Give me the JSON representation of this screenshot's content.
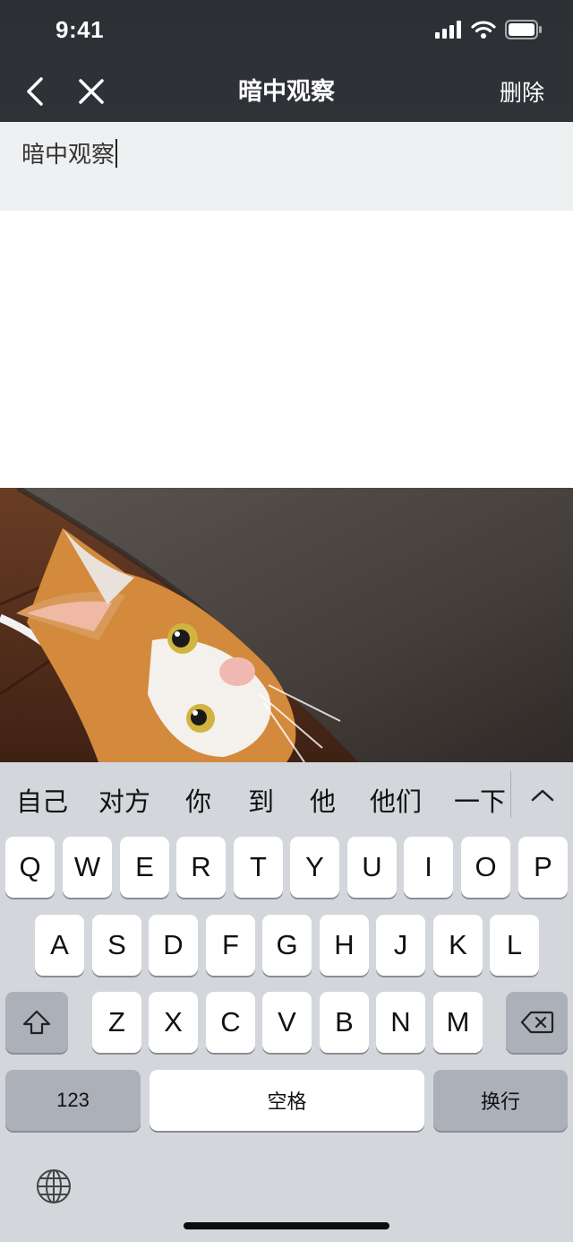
{
  "status_bar": {
    "time": "9:41"
  },
  "nav": {
    "title": "暗中观察",
    "delete_label": "删除"
  },
  "editor": {
    "title_value": "暗中观察"
  },
  "photo": {
    "description": "cat-peeking-under-sofa"
  },
  "keyboard": {
    "candidates": [
      "自己",
      "对方",
      "你",
      "到",
      "他",
      "他们",
      "一下"
    ],
    "row1": [
      "Q",
      "W",
      "E",
      "R",
      "T",
      "Y",
      "U",
      "I",
      "O",
      "P"
    ],
    "row2": [
      "A",
      "S",
      "D",
      "F",
      "G",
      "H",
      "J",
      "K",
      "L"
    ],
    "row3": [
      "Z",
      "X",
      "C",
      "V",
      "B",
      "N",
      "M"
    ],
    "numbers_label": "123",
    "space_label": "空格",
    "return_label": "换行"
  },
  "colors": {
    "header_bg": "#2f3237",
    "keyboard_bg": "#d3d6db",
    "title_bg": "#eff0f1"
  }
}
